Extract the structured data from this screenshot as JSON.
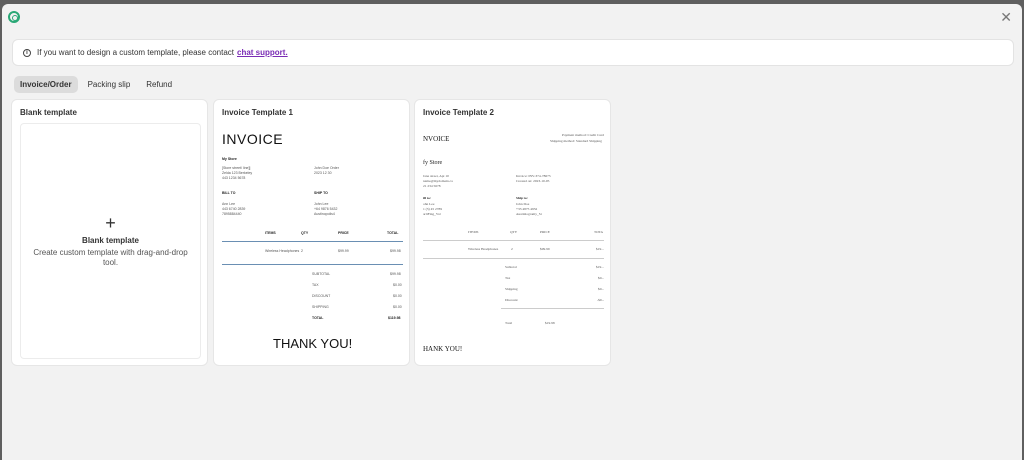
{
  "banner": {
    "text": "If you want to design a custom template, please contact",
    "link": "chat support."
  },
  "tabs": [
    "Invoice/Order",
    "Packing slip",
    "Refund"
  ],
  "cards": {
    "blank": {
      "title": "Blank template",
      "heading": "Blank template",
      "desc": "Create custom template with drag-and-drop tool."
    },
    "t1": {
      "title": "Invoice Template 1",
      "heading": "INVOICE",
      "store": "My Store",
      "store_lines": [
        "[Store street/ line]]",
        "Zelda 123 Berkeley",
        "443 1234 5678"
      ],
      "order_lines": [
        "John Doe Order",
        "2023 12 30"
      ],
      "bill_to": "BILL TO",
      "ship_to": "SHIP TO",
      "bill_lines": [
        "Ann Lee",
        "443 6740 2839",
        "7895884440"
      ],
      "ship_lines": [
        "John Lee",
        "+64 9876 5432",
        "Austinopolis4"
      ],
      "cols": [
        "ITEMS",
        "QTY",
        "PRICE",
        "TOTAL"
      ],
      "item": {
        "name": "Wireless Headphones",
        "qty": "2",
        "price": "$99.99",
        "total": "$99.98"
      },
      "summary": [
        {
          "k": "SUBTOTAL",
          "v": "$99.98"
        },
        {
          "k": "TAX",
          "v": "$0.00"
        },
        {
          "k": "DISCOUNT",
          "v": "$0.00"
        },
        {
          "k": "SHIPPING",
          "v": "$0.00"
        },
        {
          "k": "TOTAL",
          "v": "$119.98"
        }
      ],
      "thanks": "THANK YOU!"
    },
    "t2": {
      "title": "Invoice Template 2",
      "heading": "NVOICE",
      "meta_lines": [
        "Payment method: Credit Card",
        "Shipping method: Standard Shipping"
      ],
      "store": "fy Store",
      "store_lines": [
        "Jane street, Apt 10",
        "name@mydomain.ca",
        "21 234 5678"
      ],
      "invoice_lines": [
        "Invoice: INV-374-78675",
        "Created on: 2023-10-05"
      ],
      "bill_to": "ill to:",
      "ship_to": "Ship to:",
      "bill_lines": [
        "ohn Lee",
        "1 (3) 45 2789",
        "arltFing_Vol"
      ],
      "ship_lines": [
        "John Doe",
        "+33 4875 4932",
        "Austinlogramy_St"
      ],
      "cols": [
        "ITEMS",
        "QTY",
        "PRICE",
        "TOTA"
      ],
      "item": {
        "name": "Wireless Headphones",
        "qty": "2",
        "price": "$99.99",
        "total": "$19..."
      },
      "summary": [
        {
          "k": "Subtotal",
          "v": "$19..."
        },
        {
          "k": "Tax",
          "v": "$0..."
        },
        {
          "k": "Shipping",
          "v": "$0..."
        },
        {
          "k": "Discount",
          "v": "-$0..."
        }
      ],
      "total": {
        "k": "Total",
        "v": "$19.98"
      },
      "thanks": "HANK YOU!"
    }
  }
}
